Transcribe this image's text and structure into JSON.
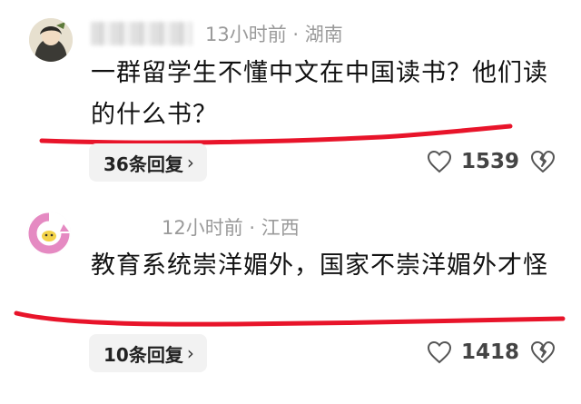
{
  "comments": [
    {
      "author": "",
      "time": "13小时前",
      "location": "湖南",
      "text": "一群留学生不懂中文在中国读书？他们读的什么书？",
      "reply_label": "36条回复",
      "like_count": "1539",
      "icons": {
        "like": "heart-outline-icon",
        "dislike": "broken-heart-icon",
        "chevron": "chevron-right-icon"
      }
    },
    {
      "author": "",
      "time": "12小时前",
      "location": "江西",
      "text": "教育系统崇洋媚外，国家不崇洋媚外才怪",
      "reply_label": "10条回复",
      "like_count": "1418",
      "icons": {
        "like": "heart-outline-icon",
        "dislike": "broken-heart-icon",
        "chevron": "chevron-right-icon"
      }
    }
  ],
  "meta_separator": " · ",
  "reply_chevron": "›",
  "colors": {
    "meta": "#9a9a9a",
    "underline": "#e8142a",
    "reply_bg": "#f2f2f2",
    "text": "#111111"
  }
}
